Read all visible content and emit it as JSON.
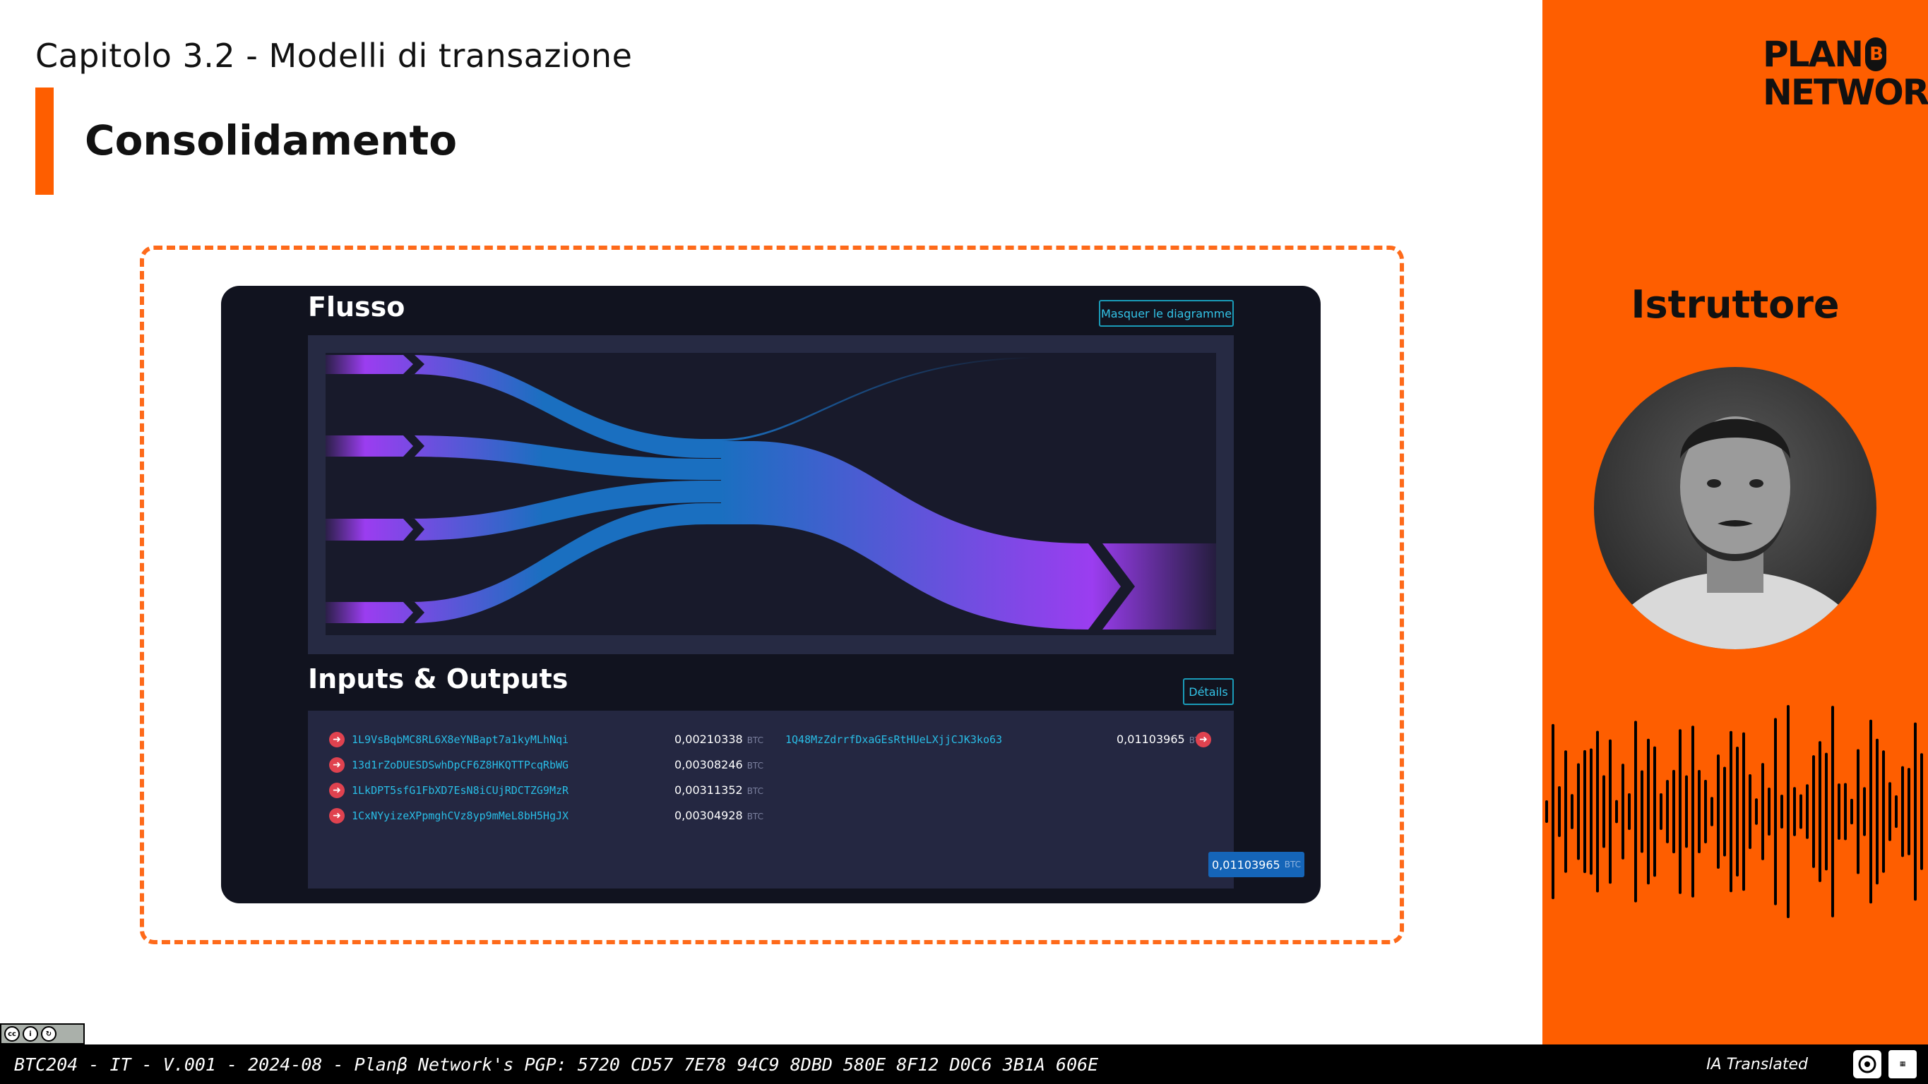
{
  "header": {
    "chapter": "Capitolo 3.2 - Modelli di transazione",
    "title": "Consolidamento"
  },
  "explorer": {
    "flow_title": "Flusso",
    "hide_diagram_label": "Masquer le diagramme",
    "io_title": "Inputs & Outputs",
    "details_label": "Détails",
    "unit": "BTC",
    "inputs": [
      {
        "address": "1L9VsBqbMC8RL6X8eYNBapt7a1kyMLhNqi",
        "amount": "0,00210338"
      },
      {
        "address": "13d1rZoDUESDSwhDpCF6Z8HKQTTPcqRbWG",
        "amount": "0,00308246"
      },
      {
        "address": "1LkDPT5sfG1FbXD7EsN8iCUjRDCTZG9MzR",
        "amount": "0,00311352"
      },
      {
        "address": "1CxNYyizeXPpmghCVz8yp9mMeL8bH5HgJX",
        "amount": "0,00304928"
      }
    ],
    "outputs": [
      {
        "address": "1Q48MzZdrrfDxaGEsRtHUeLXjjCJK3ko63",
        "amount": "0,01103965"
      }
    ],
    "total": "0,01103965",
    "colors": {
      "flow_start": "#9b3df0",
      "flow_mid": "#1a6fc0",
      "panel": "#262a43",
      "accent_link": "#29bde6"
    }
  },
  "side": {
    "logo_line1": "PLAN",
    "logo_b": "B",
    "logo_line2": "NETWORK",
    "instructor_label": "Istruttore",
    "accent_color": "#fe5e00"
  },
  "footer": {
    "text": "BTC204 - IT - V.001 - 2024-08 - Planβ Network's PGP: 5720 CD57 7E78 94C9 8DBD 580E 8F12 D0C6 3B1A 606E",
    "translated_label": "IA Translated",
    "license": "cc by sa"
  }
}
